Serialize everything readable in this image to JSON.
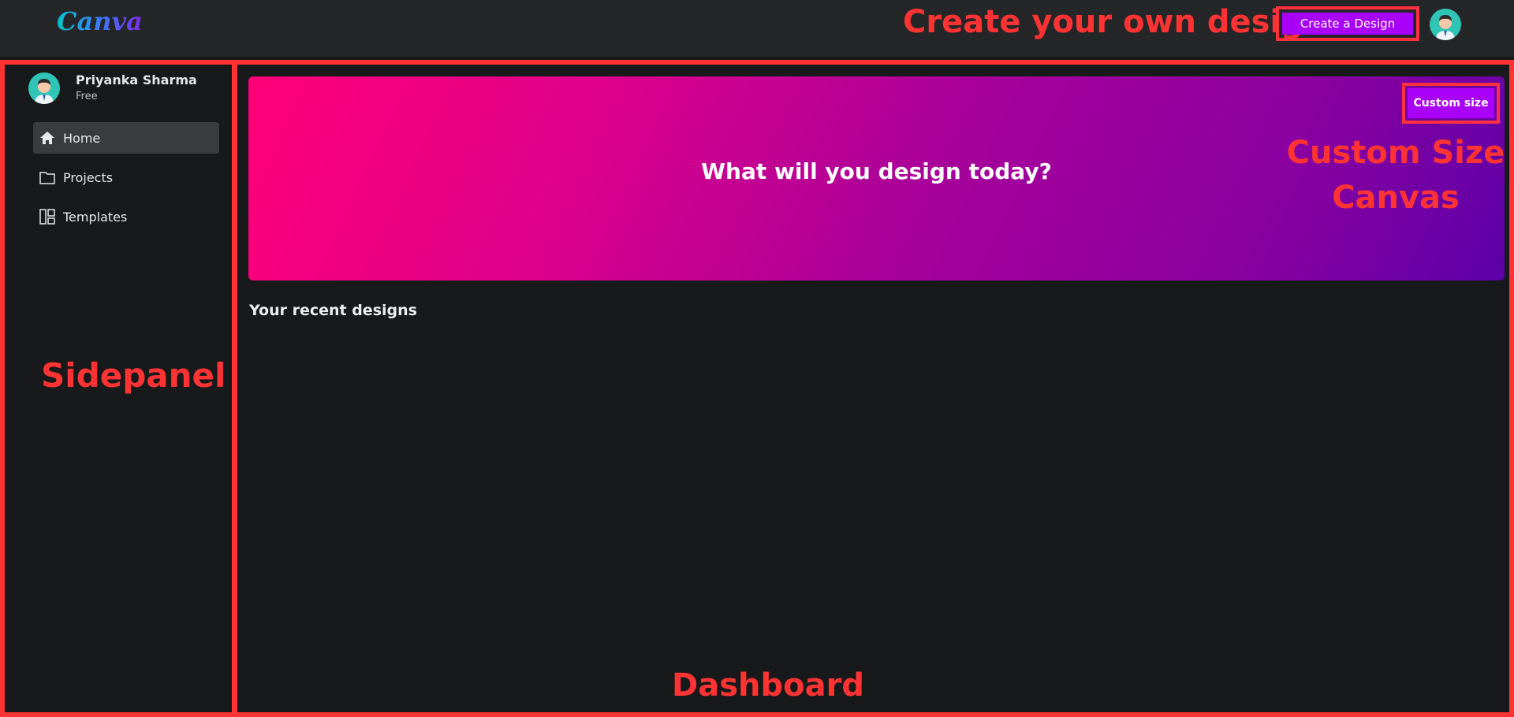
{
  "topbar": {
    "logo": "Canva",
    "create_button_label": "Create a Design",
    "annotation": "Create your own design"
  },
  "user": {
    "name": "Priyanka Sharma",
    "plan": "Free"
  },
  "sidebar": {
    "items": [
      {
        "label": "Home",
        "icon": "home-icon",
        "active": true
      },
      {
        "label": "Projects",
        "icon": "folder-icon",
        "active": false
      },
      {
        "label": "Templates",
        "icon": "templates-icon",
        "active": false
      }
    ],
    "annotation": "Sidepanel"
  },
  "hero": {
    "title": "What will you design today?",
    "custom_size_label": "Custom size",
    "annotation_line1": "Custom Size",
    "annotation_line2": "Canvas"
  },
  "main": {
    "recent_title": "Your recent designs",
    "annotation": "Dashboard"
  },
  "colors": {
    "accent": "#a900f7",
    "annotation_red": "#ff3333",
    "background": "#18191b",
    "topbar": "#252627"
  }
}
